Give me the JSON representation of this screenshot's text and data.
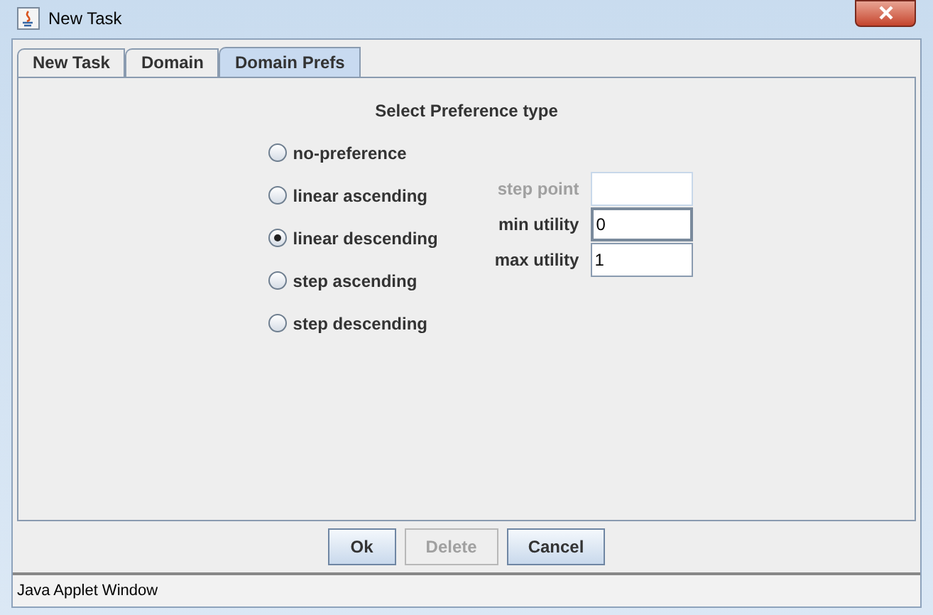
{
  "window": {
    "title": "New Task"
  },
  "tabs": [
    {
      "label": "New Task",
      "selected": false
    },
    {
      "label": "Domain",
      "selected": false
    },
    {
      "label": "Domain Prefs",
      "selected": true
    }
  ],
  "heading": "Select Preference type",
  "options": [
    {
      "label": "no-preference",
      "selected": false
    },
    {
      "label": "linear ascending",
      "selected": false
    },
    {
      "label": "linear descending",
      "selected": true
    },
    {
      "label": "step ascending",
      "selected": false
    },
    {
      "label": "step descending",
      "selected": false
    }
  ],
  "fields": [
    {
      "label": "step point",
      "disabled": true,
      "focused": false
    },
    {
      "label": "min utility",
      "value": "0",
      "disabled": false,
      "focused": true
    },
    {
      "label": "max utility",
      "value": "1",
      "disabled": false,
      "focused": false
    }
  ],
  "buttons": [
    {
      "label": "Ok",
      "disabled": false
    },
    {
      "label": "Delete",
      "disabled": true
    },
    {
      "label": "Cancel",
      "disabled": false
    }
  ],
  "status_bar": "Java Applet Window"
}
